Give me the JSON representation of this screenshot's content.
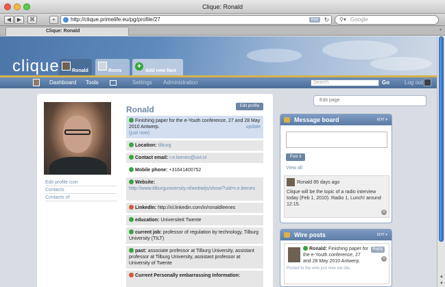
{
  "browser": {
    "window_title": "Clique: Ronald",
    "url": "http://clique.primelife.eu/pg/profile/27",
    "rss_label": "RSS",
    "search_placeholder": "Google",
    "tab_label": "Clique: Ronald"
  },
  "header": {
    "logo": "clique",
    "tabs": [
      {
        "label": "Ronald"
      },
      {
        "label": "Ronis"
      },
      {
        "label": "Add new face"
      }
    ]
  },
  "nav": {
    "items": [
      "Dashboard",
      "Tools",
      "Settings",
      "Administration"
    ],
    "search_placeholder": "Search",
    "go": "Go",
    "logout": "Log out"
  },
  "profile": {
    "name": "Ronald",
    "edit_button": "Edit profile",
    "links": [
      "Edit profile icon",
      "Contacts",
      "Contacts of"
    ],
    "status": {
      "text": "Finishing paper for the e-Youth conference, 27 and 28 May 2010 Antwerp.",
      "update": "update",
      "time": "(just now)"
    },
    "location_label": "Location:",
    "location_value": "tilburg",
    "email_label": "Contact email:",
    "email_value": "r.e.leenes@uvt.nl",
    "phone_label": "Mobile phone:",
    "phone_value": "+31641400752",
    "website_label": "Website:",
    "website_value": "http://www.tilburguniversity.nl/webwijs/show/?uid=r.e.leenes",
    "linkedin_label": "LinkedIn:",
    "linkedin_value": "http://nl.linkedin.com/in/ronaldleenes",
    "education_label": "education:",
    "education_value": "Universiteit Twente",
    "job_label": "current job:",
    "job_value": "professor of regulation by technology, Tilburg University (TILT)",
    "past_label": "past:",
    "past_value": "associate professor at Tilburg University, assistant professor at Tilburg University, assistant professor at University of Twente",
    "embarrassing_label": "Current Personally embarrassing Information:"
  },
  "sidebar": {
    "edit_page": "Edit page",
    "message_board": {
      "title": "Message board",
      "edit": "EDIT",
      "post_button": "Post it",
      "view_all": "View all",
      "msg_author": "Ronald",
      "msg_time": "85 days ago",
      "msg_text": "Clique will be the topic of a radio interview today (Feb 1, 2010). Radio 1, Lunch! around 12:15."
    },
    "wire_posts": {
      "title": "Wire posts",
      "edit": "EDIT",
      "reply": "Reply",
      "author": "Ronald:",
      "text": "Finishing paper for the e-Youth conference, 27 and 28 May 2010 Antwerp.",
      "footer": "Posted to the wire just now via site."
    }
  }
}
